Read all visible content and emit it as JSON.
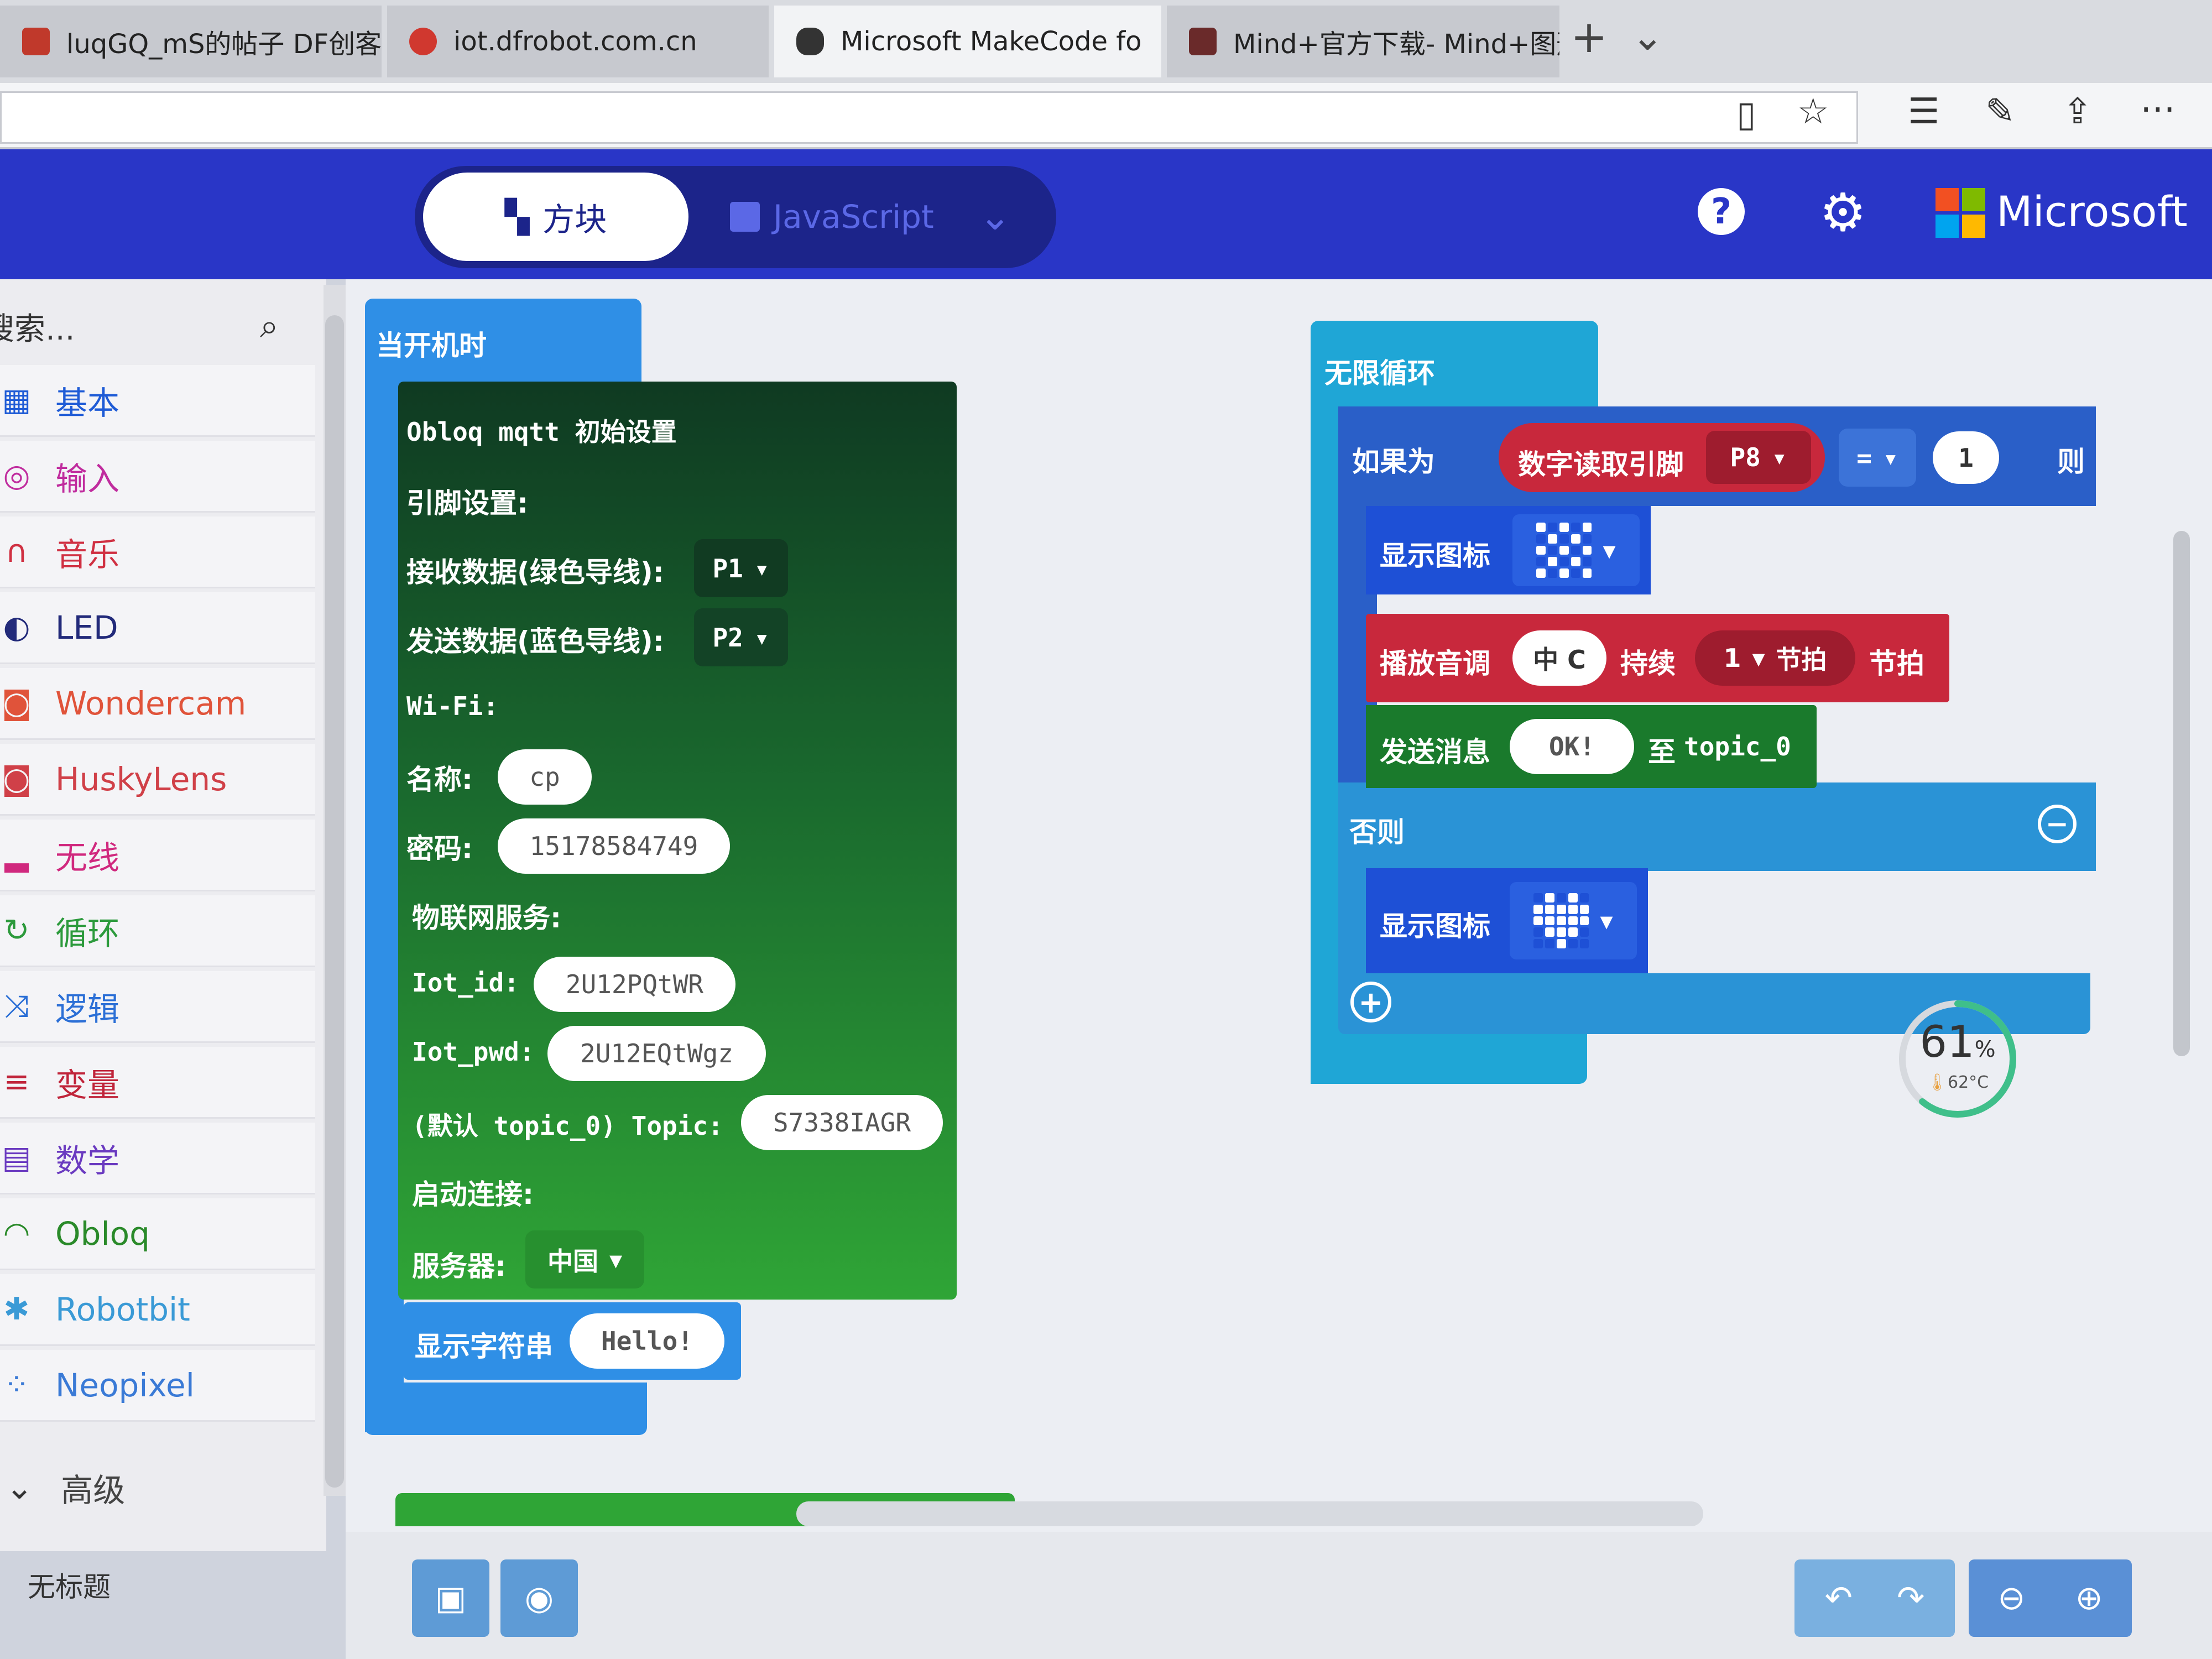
{
  "browser": {
    "tabs": [
      {
        "title": "luqGQ_mS的帖子 DF创客社",
        "icon_color": "#c0392b"
      },
      {
        "title": "iot.dfrobot.com.cn",
        "icon_color": "#d0382f"
      },
      {
        "title": "Microsoft MakeCode fo",
        "icon_color": "#333333",
        "active": true
      },
      {
        "title": "Mind+官方下载- Mind+图形",
        "icon_color": "#6a2a2a"
      }
    ],
    "close_glyph": "✕",
    "new_tab_glyph": "+",
    "tab_menu_glyph": "⌄",
    "toolbar_icons": [
      "reading-view-icon",
      "favorite-star-icon",
      "favorites-hub-icon",
      "pen-icon",
      "share-icon",
      "more-icon"
    ]
  },
  "header": {
    "blocks_label": "方块",
    "js_label": "JavaScript",
    "help_glyph": "?",
    "brand": "Microsoft",
    "colors": {
      "header": "#2936c7",
      "toggle": "#1c248a"
    }
  },
  "toolbox": {
    "search_placeholder": "搜索...",
    "categories": [
      {
        "label": "基本",
        "color": "#1e5bd6",
        "icon": "grid-icon"
      },
      {
        "label": "输入",
        "color": "#c02c9e",
        "icon": "input-icon"
      },
      {
        "label": "音乐",
        "color": "#d03042",
        "icon": "headphones-icon"
      },
      {
        "label": "LED",
        "color": "#222a7a",
        "icon": "toggle-icon"
      },
      {
        "label": "Wondercam",
        "color": "#e0533a",
        "icon": "camera-icon"
      },
      {
        "label": "HuskyLens",
        "color": "#d04048",
        "icon": "camera-icon"
      },
      {
        "label": "无线",
        "color": "#d0287e",
        "icon": "signal-icon"
      },
      {
        "label": "循环",
        "color": "#2c9a3c",
        "icon": "loop-icon"
      },
      {
        "label": "逻辑",
        "color": "#2b6fd6",
        "icon": "shuffle-icon"
      },
      {
        "label": "变量",
        "color": "#c0243a",
        "icon": "list-icon"
      },
      {
        "label": "数学",
        "color": "#6a3ac0",
        "icon": "calculator-icon"
      },
      {
        "label": "Obloq",
        "color": "#2a8a2a",
        "icon": "wifi-icon"
      },
      {
        "label": "Robotbit",
        "color": "#3a9ad6",
        "icon": "robot-icon"
      },
      {
        "label": "Neopixel",
        "color": "#3a7ad6",
        "icon": "dots-icon"
      }
    ],
    "advanced_label": "高级",
    "project_name": "无标题"
  },
  "on_start": {
    "hat_label": "当开机时",
    "obloq": {
      "title": "Obloq mqtt 初始设置",
      "pin_settings": "引脚设置:",
      "rx_label": "接收数据(绿色导线):",
      "rx_pin": "P1",
      "tx_label": "发送数据(蓝色导线):",
      "tx_pin": "P2",
      "wifi_label": "Wi-Fi:",
      "name_label": "名称:",
      "name_value": "cp",
      "pwd_label": "密码:",
      "pwd_value": "15178584749",
      "iot_label": "物联网服务:",
      "iot_id_label": "Iot_id:",
      "iot_id_value": "2U12PQtWR",
      "iot_pwd_label": "Iot_pwd:",
      "iot_pwd_value": "2U12EQtWgz",
      "topic_label": "(默认 topic_0) Topic:",
      "topic_value": "S7338IAGR",
      "connect_label": "启动连接:",
      "server_label": "服务器:",
      "server_value": "中国"
    },
    "show_string_label": "显示字符串",
    "show_string_value": "Hello!"
  },
  "forever": {
    "hat_label": "无限循环",
    "if_label": "如果为",
    "digital_read_label": "数字读取引脚",
    "digital_pin": "P8",
    "operator": "=",
    "compare_value": "1",
    "then_label": "则",
    "show_icon_label": "显示图标",
    "play_tone_label": "播放音调",
    "tone_value": "中 C",
    "duration_label": "持续",
    "beats_value": "1",
    "beat_unit": "节拍",
    "beat_label": "节拍",
    "send_msg_label": "发送消息",
    "send_msg_value": "OK!",
    "to_label": "至",
    "topic_var": "topic_0",
    "else_label": "否则",
    "else_show_icon_label": "显示图标"
  },
  "overlay": {
    "percent": "61",
    "percent_unit": "%",
    "temperature": "62°C",
    "ring_fraction": 0.61
  },
  "colors": {
    "hat_blue": "#2f8fe6",
    "obloq_green_top": "#0f3a22",
    "obloq_green_bottom": "#2fa536",
    "loop_cyan": "#1fa6d6",
    "music_red": "#c8283c",
    "logic_blue": "#2a5fc8"
  }
}
